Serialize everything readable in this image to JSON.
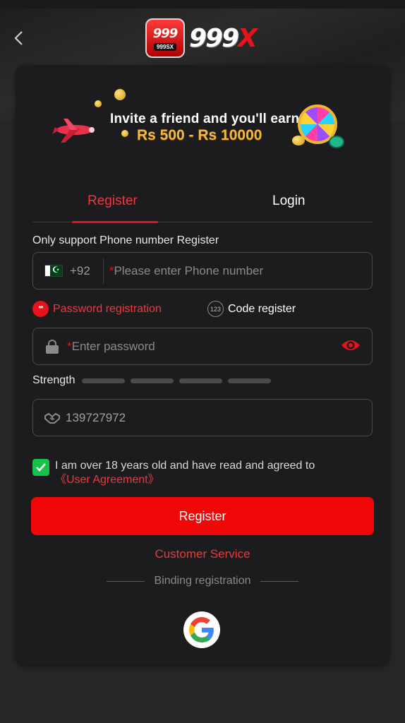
{
  "header": {
    "back_icon": "chevron-left-icon",
    "logo_badge_top": "999",
    "logo_badge_bottom": "999SX",
    "logo_text_white": "999",
    "logo_text_red": "X"
  },
  "banner": {
    "line1": "Invite a friend and you'll earn",
    "line2": "Rs 500 - Rs 10000"
  },
  "tabs": [
    {
      "label": "Register",
      "active": true
    },
    {
      "label": "Login",
      "active": false
    }
  ],
  "form": {
    "hint": "Only support Phone number Register",
    "country_code": "+92",
    "phone_placeholder_star": "*",
    "phone_placeholder": "Please enter Phone number",
    "options": [
      {
        "label": "Password registration",
        "icon": "asterisks-icon",
        "selected": true
      },
      {
        "label": "Code register",
        "icon": "123-icon",
        "selected": false
      }
    ],
    "dot_text": "**",
    "code_icon_text": "123",
    "password_placeholder_star": "*",
    "password_placeholder": "Enter password",
    "strength_label": "Strength",
    "invite_code": "139727972",
    "agree_text": "I am over 18 years old and have read and agreed to",
    "agree_link": "《User Agreement》",
    "agree_checked": true,
    "submit_label": "Register",
    "customer_service": "Customer Service",
    "binding_label": "Binding registration"
  },
  "colors": {
    "accent": "#e8121b",
    "button": "#f00808",
    "checkbox": "#16c24a",
    "card": "#1c1c1e"
  }
}
